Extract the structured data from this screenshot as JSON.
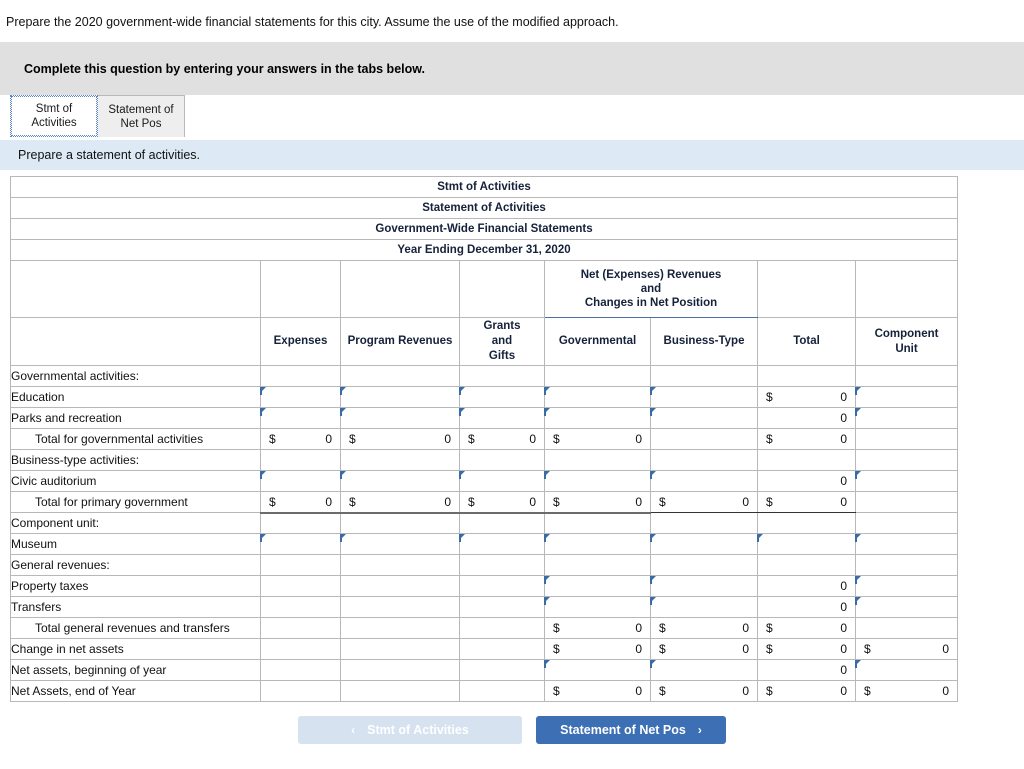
{
  "prompt": "Prepare the 2020 government-wide financial statements for this city. Assume the use of the modified approach.",
  "banner": {
    "text": "Complete this question by entering your answers in the tabs below."
  },
  "tabs": [
    {
      "line1": "Stmt of",
      "line2": "Activities",
      "active": true
    },
    {
      "line1": "Statement of",
      "line2": "Net Pos",
      "active": false
    }
  ],
  "sub_instruction": "Prepare a statement of activities.",
  "sheet": {
    "title_rows": [
      "Stmt of Activities",
      "Statement of Activities",
      "Government-Wide Financial Statements",
      "Year Ending December 31, 2020"
    ],
    "group_header": "Net (Expenses) Revenues\nand\nChanges in Net Position",
    "group_header_lines": [
      "Net (Expenses) Revenues",
      "and",
      "Changes in Net Position"
    ],
    "column_headers": {
      "label": "",
      "expenses": "Expenses",
      "program_revenues": "Program Revenues",
      "grants_and_gifts_lines": [
        "Grants",
        "and",
        "Gifts"
      ],
      "governmental": "Governmental",
      "business_type": "Business-Type",
      "total": "Total",
      "component_unit_lines": [
        "Component",
        "Unit"
      ]
    },
    "rows": [
      {
        "label": "Governmental activities:"
      },
      {
        "label": "Education"
      },
      {
        "label": "Parks and recreation"
      },
      {
        "label": "Total for governmental activities"
      },
      {
        "label": "Business-type activities:"
      },
      {
        "label": "Civic auditorium"
      },
      {
        "label": "Total for primary government"
      },
      {
        "label": "Component unit:"
      },
      {
        "label": "Museum"
      },
      {
        "label": "General revenues:"
      },
      {
        "label": "Property taxes"
      },
      {
        "label": "Transfers"
      },
      {
        "label": "Total general revenues and transfers"
      },
      {
        "label": "Change in net assets"
      },
      {
        "label": "Net assets, beginning of year"
      },
      {
        "label": "Net Assets, end of Year"
      }
    ],
    "dollar_sign": "$",
    "zero": "0"
  },
  "nav": {
    "prev_label": "Stmt of Activities",
    "prev_chevron": "‹",
    "next_label": "Statement of Net Pos",
    "next_chevron": "›"
  },
  "colors": {
    "header_blue": "#8bb2dd",
    "banner_gray": "#e0e0e0",
    "sub_blue": "#ddeaf6",
    "input_border": "#4a74ae",
    "next_button": "#3d6fb4",
    "prev_button": "#d6e2f0"
  }
}
